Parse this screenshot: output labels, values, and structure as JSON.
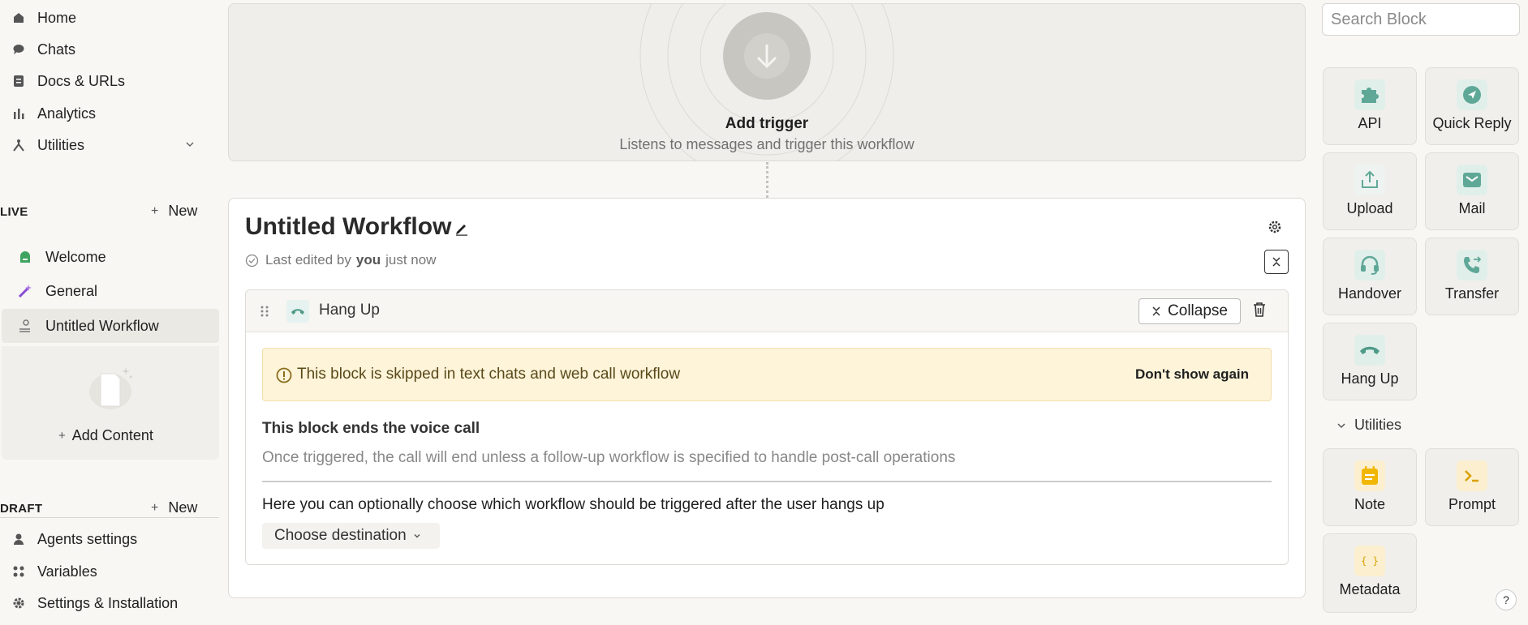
{
  "sidebar": {
    "nav": [
      {
        "label": "Home",
        "icon": "home-icon"
      },
      {
        "label": "Chats",
        "icon": "chat-icon"
      },
      {
        "label": "Docs & URLs",
        "icon": "document-icon"
      },
      {
        "label": "Analytics",
        "icon": "bar-chart-icon"
      },
      {
        "label": "Utilities",
        "icon": "utilities-icon"
      }
    ],
    "live": {
      "label": "LIVE",
      "new_label": "New",
      "items": [
        {
          "label": "Welcome",
          "icon": "welcome-icon"
        },
        {
          "label": "General",
          "icon": "magic-wand-icon"
        },
        {
          "label": "Untitled Workflow",
          "icon": "workflow-icon",
          "active": true
        }
      ],
      "add_content": "Add Content"
    },
    "draft": {
      "label": "DRAFT",
      "new_label": "New"
    },
    "bottom": [
      {
        "label": "Agents settings",
        "icon": "agents-icon"
      },
      {
        "label": "Variables",
        "icon": "variables-icon"
      },
      {
        "label": "Settings & Installation",
        "icon": "settings-icon"
      }
    ]
  },
  "trigger": {
    "title": "Add trigger",
    "subtitle": "Listens to messages and trigger this workflow"
  },
  "workflow": {
    "title": "Untitled Workflow",
    "meta_prefix": "Last edited by",
    "meta_user": "you",
    "meta_suffix": "just now",
    "block": {
      "name": "Hang Up",
      "collapse_label": "Collapse",
      "warning": "This block is skipped in text chats and web call workflow",
      "warning_action": "Don't show again",
      "ends_title": "This block ends the voice call",
      "ends_desc": "Once triggered, the call will end unless a follow-up workflow is specified to handle post-call operations",
      "choose_title": "Here you can optionally choose which workflow should be triggered after the user hangs up",
      "destination_label": "Choose destination"
    }
  },
  "panel": {
    "search_placeholder": "Search Block",
    "blocks": [
      {
        "label": "API",
        "icon": "puzzle-icon"
      },
      {
        "label": "Quick Reply",
        "icon": "send-icon"
      },
      {
        "label": "Upload",
        "icon": "upload-icon"
      },
      {
        "label": "Mail",
        "icon": "mail-icon"
      },
      {
        "label": "Handover",
        "icon": "headset-icon"
      },
      {
        "label": "Transfer",
        "icon": "phone-forward-icon"
      },
      {
        "label": "Hang Up",
        "icon": "hang-up-icon"
      }
    ],
    "utilities_label": "Utilities",
    "utilities": [
      {
        "label": "Note",
        "icon": "note-icon"
      },
      {
        "label": "Prompt",
        "icon": "terminal-icon"
      },
      {
        "label": "Metadata",
        "icon": "braces-icon"
      }
    ],
    "help": "?"
  },
  "colors": {
    "accent_green": "#5fa898",
    "warning_bg": "#fdf4d9",
    "note_yellow": "#f2b705"
  }
}
